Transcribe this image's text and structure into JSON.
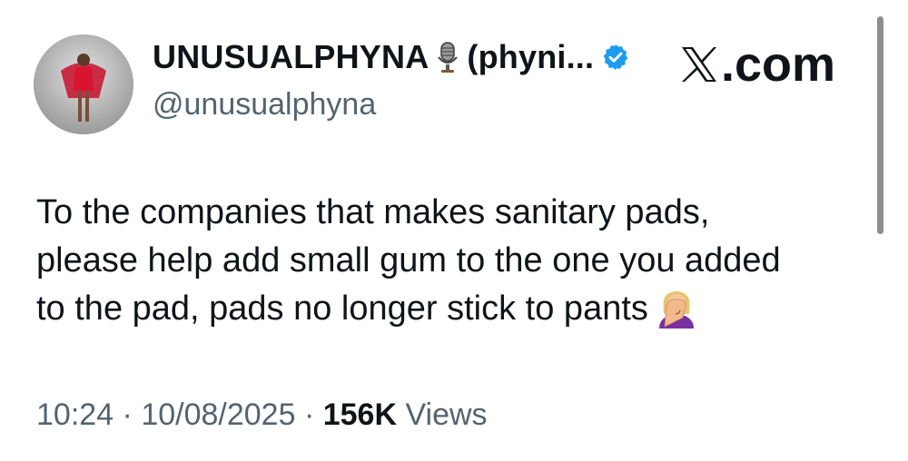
{
  "author": {
    "display_name": "UNUSUALPHYNA",
    "display_name_suffix": "(phyni...",
    "handle": "@unusualphyna",
    "verified": true,
    "name_emoji_icon": "microphone-icon",
    "verified_icon": "verified-badge-icon"
  },
  "brand": {
    "label": ".com",
    "logo_icon": "x-logo-icon"
  },
  "tweet": {
    "lines": [
      "To the companies that makes sanitary pads,",
      "please help add small gum to the one you added",
      "to the pad, pads no longer stick to pants"
    ],
    "end_emoji_icon": "facepalm-emoji-icon"
  },
  "meta": {
    "time": "10:24",
    "separator": "·",
    "date": "10/08/2025",
    "views_count": "156K",
    "views_label": "Views"
  },
  "colors": {
    "text": "#0f1419",
    "secondary": "#536471",
    "verified": "#1d9bf0",
    "scrollbar": "#8e8e8e"
  }
}
